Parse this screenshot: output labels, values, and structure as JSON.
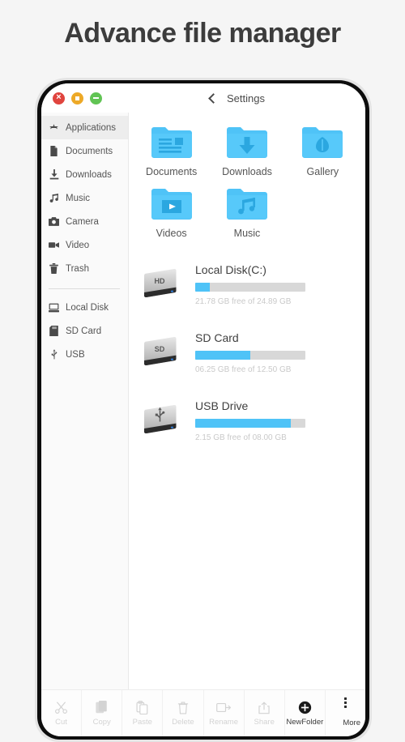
{
  "page": {
    "title": "Advance file manager"
  },
  "window": {
    "controls": [
      {
        "name": "close",
        "glyph": "×",
        "color": "#e0443e"
      },
      {
        "name": "minimize",
        "glyph": "■",
        "color": "#eda927"
      },
      {
        "name": "zoom",
        "glyph": "−",
        "color": "#61c454"
      }
    ],
    "back_icon": "chevron-left-icon",
    "nav_title": "Settings"
  },
  "sidebar": {
    "items": [
      {
        "label": "Applications",
        "icon": "applications-icon",
        "selected": true
      },
      {
        "label": "Documents",
        "icon": "document-icon",
        "selected": false
      },
      {
        "label": "Downloads",
        "icon": "download-icon",
        "selected": false
      },
      {
        "label": "Music",
        "icon": "music-note-icon",
        "selected": false
      },
      {
        "label": "Camera",
        "icon": "camera-icon",
        "selected": false
      },
      {
        "label": "Video",
        "icon": "video-camera-icon",
        "selected": false
      },
      {
        "label": "Trash",
        "icon": "trash-icon",
        "selected": false
      }
    ],
    "devices": [
      {
        "label": "Local Disk",
        "icon": "hard-disk-icon"
      },
      {
        "label": "SD Card",
        "icon": "sd-card-icon"
      },
      {
        "label": "USB",
        "icon": "usb-icon"
      }
    ]
  },
  "folders": [
    {
      "label": "Documents",
      "icon": "folder-documents-icon"
    },
    {
      "label": "Downloads",
      "icon": "folder-downloads-icon"
    },
    {
      "label": "Gallery",
      "icon": "folder-gallery-icon"
    },
    {
      "label": "Videos",
      "icon": "folder-videos-icon"
    },
    {
      "label": "Music",
      "icon": "folder-music-icon"
    }
  ],
  "storage": [
    {
      "name": "Local Disk(C:)",
      "icon": "drive-hd-icon",
      "badge": "HD",
      "used_percent": 13,
      "detail": "21.78 GB free of 24.89 GB"
    },
    {
      "name": "SD Card",
      "icon": "drive-sd-icon",
      "badge": "SD",
      "used_percent": 50,
      "detail": "06.25 GB free of 12.50 GB"
    },
    {
      "name": "USB Drive",
      "icon": "drive-usb-icon",
      "badge": "USB",
      "used_percent": 87,
      "detail": "2.15 GB free of 08.00 GB"
    }
  ],
  "toolbar": [
    {
      "label": "Cut",
      "icon": "scissors-icon",
      "enabled": false
    },
    {
      "label": "Copy",
      "icon": "copy-icon",
      "enabled": false
    },
    {
      "label": "Paste",
      "icon": "paste-icon",
      "enabled": false
    },
    {
      "label": "Delete",
      "icon": "trash-icon",
      "enabled": false
    },
    {
      "label": "Rename",
      "icon": "rename-icon",
      "enabled": false
    },
    {
      "label": "Share",
      "icon": "share-icon",
      "enabled": false
    },
    {
      "label": "NewFolder",
      "icon": "plus-circle-icon",
      "enabled": true
    },
    {
      "label": "More",
      "icon": "more-vertical-icon",
      "enabled": true
    }
  ],
  "colors": {
    "accent_blue": "#4fc3f7",
    "folder_blue": "#4fc3f7",
    "title_gray": "#3c3c3c",
    "track_gray": "#d8d8d8"
  }
}
